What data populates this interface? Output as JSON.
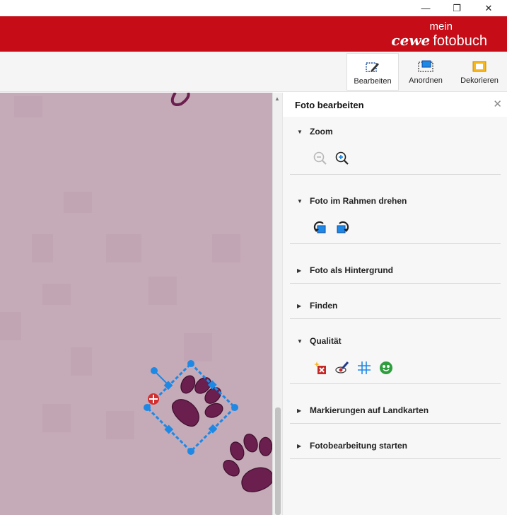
{
  "window": {
    "minimize_glyph": "—",
    "maximize_glyph": "❐",
    "close_glyph": "✕"
  },
  "brand": {
    "mein": "mein",
    "cewe": "cewe",
    "fotobuch": "fotobuch",
    "color": "#c50c17"
  },
  "toolbar": {
    "items": [
      {
        "label": "Bearbeiten",
        "icon": "edit-photo-icon",
        "active": true
      },
      {
        "label": "Anordnen",
        "icon": "arrange-icon",
        "active": false
      },
      {
        "label": "Dekorieren",
        "icon": "decorate-icon",
        "active": false
      }
    ]
  },
  "panel": {
    "title": "Foto bearbeiten",
    "close_glyph": "✕",
    "sections": [
      {
        "label": "Zoom",
        "expanded": true,
        "icons": [
          "zoom-out-icon",
          "zoom-in-icon"
        ]
      },
      {
        "label": "Foto im Rahmen drehen",
        "expanded": true,
        "icons": [
          "rotate-left-icon",
          "rotate-right-icon"
        ]
      },
      {
        "label": "Foto als Hintergrund",
        "expanded": false
      },
      {
        "label": "Finden",
        "expanded": false
      },
      {
        "label": "Qualität",
        "expanded": true,
        "icons": [
          "auto-fix-icon",
          "red-eye-icon",
          "grid-icon",
          "smiley-icon"
        ]
      },
      {
        "label": "Markierungen auf Landkarten",
        "expanded": false
      },
      {
        "label": "Fotobearbeitung starten",
        "expanded": false
      }
    ]
  },
  "canvas": {
    "background": "#c5aab8",
    "paw_color": "#6b1f4f",
    "selection_color": "#1e88e5"
  }
}
